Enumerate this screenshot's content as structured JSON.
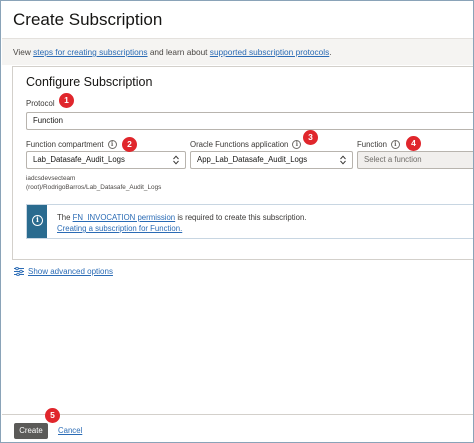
{
  "header": {
    "title": "Create Subscription"
  },
  "description": {
    "prefix": "View ",
    "link1": "steps for creating subscriptions",
    "middle": " and learn about ",
    "link2": "supported subscription protocols",
    "suffix": "."
  },
  "section": {
    "title": "Configure Subscription"
  },
  "protocol": {
    "label": "Protocol",
    "value": "Function"
  },
  "function_compartment": {
    "label": "Function compartment",
    "value": "Lab_Datasafe_Audit_Logs",
    "path": "iadcsdevsecteam (root)/RodrigoBarros/Lab_Datasafe_Audit_Logs"
  },
  "functions_application": {
    "label": "Oracle Functions application",
    "value": "App_Lab_Datasafe_Audit_Logs"
  },
  "function": {
    "label": "Function",
    "placeholder": "Select a function"
  },
  "info_message": {
    "prefix": "The ",
    "link": "FN_INVOCATION permission",
    "suffix": " is required to create this subscription.",
    "link2": "Creating a subscription for Function."
  },
  "advanced": {
    "label": "Show advanced options"
  },
  "footer": {
    "create_label": "Create",
    "cancel_label": "Cancel"
  },
  "callouts": [
    "1",
    "2",
    "3",
    "4",
    "5"
  ],
  "colors": {
    "callout": "#e0262c",
    "link": "#2a6bb5",
    "info_strip": "#2a6b8f",
    "create_button": "#5b5a58"
  },
  "icons": {
    "info": "info-icon",
    "chevron": "chevron-updown-icon",
    "advanced": "sliders-icon"
  }
}
